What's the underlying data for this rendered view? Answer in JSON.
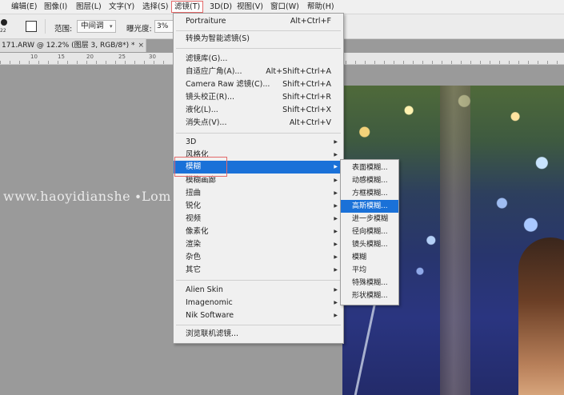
{
  "menubar": {
    "items": [
      "编辑(E)",
      "图像(I)",
      "图层(L)",
      "文字(Y)",
      "选择(S)",
      "滤镜(T)",
      "3D(D)",
      "视图(V)",
      "窗口(W)",
      "帮助(H)"
    ]
  },
  "options": {
    "brush_size": "22",
    "range_label": "范围:",
    "range_value": "中间调",
    "exposure_label": "曝光度:",
    "exposure_value": "3%"
  },
  "document_tab": {
    "title": "171.ARW @ 12.2% (图层 3, RGB/8*) *",
    "close": "×"
  },
  "ruler": {
    "labels": [
      "10",
      "15",
      "20",
      "25",
      "30"
    ]
  },
  "filter_menu": {
    "items": [
      {
        "label": "Portraiture",
        "shortcut": "Alt+Ctrl+F"
      },
      {
        "label": "转换为智能滤镜(S)",
        "shortcut": ""
      },
      {
        "label": "滤镜库(G)...",
        "shortcut": ""
      },
      {
        "label": "自适应广角(A)...",
        "shortcut": "Alt+Shift+Ctrl+A"
      },
      {
        "label": "Camera Raw 滤镜(C)...",
        "shortcut": "Shift+Ctrl+A"
      },
      {
        "label": "镜头校正(R)...",
        "shortcut": "Shift+Ctrl+R"
      },
      {
        "label": "液化(L)...",
        "shortcut": "Shift+Ctrl+X"
      },
      {
        "label": "消失点(V)...",
        "shortcut": "Alt+Ctrl+V"
      },
      {
        "label": "3D",
        "shortcut": ""
      },
      {
        "label": "风格化",
        "shortcut": ""
      },
      {
        "label": "模糊",
        "shortcut": ""
      },
      {
        "label": "模糊画廊",
        "shortcut": ""
      },
      {
        "label": "扭曲",
        "shortcut": ""
      },
      {
        "label": "锐化",
        "shortcut": ""
      },
      {
        "label": "视频",
        "shortcut": ""
      },
      {
        "label": "像素化",
        "shortcut": ""
      },
      {
        "label": "渲染",
        "shortcut": ""
      },
      {
        "label": "杂色",
        "shortcut": ""
      },
      {
        "label": "其它",
        "shortcut": ""
      },
      {
        "label": "Alien Skin",
        "shortcut": ""
      },
      {
        "label": "Imagenomic",
        "shortcut": ""
      },
      {
        "label": "Nik Software",
        "shortcut": ""
      },
      {
        "label": "浏览联机滤镜...",
        "shortcut": ""
      }
    ]
  },
  "blur_submenu": {
    "items": [
      "表面模糊...",
      "动感模糊...",
      "方框模糊...",
      "高斯模糊...",
      "进一步模糊",
      "径向模糊...",
      "镜头模糊...",
      "模糊",
      "平均",
      "特殊模糊...",
      "形状模糊..."
    ]
  },
  "watermark": "www.haoyidianshe                ∙Lom",
  "colors": {
    "highlight": "#1a71d8",
    "callout": "#e46a6a"
  }
}
